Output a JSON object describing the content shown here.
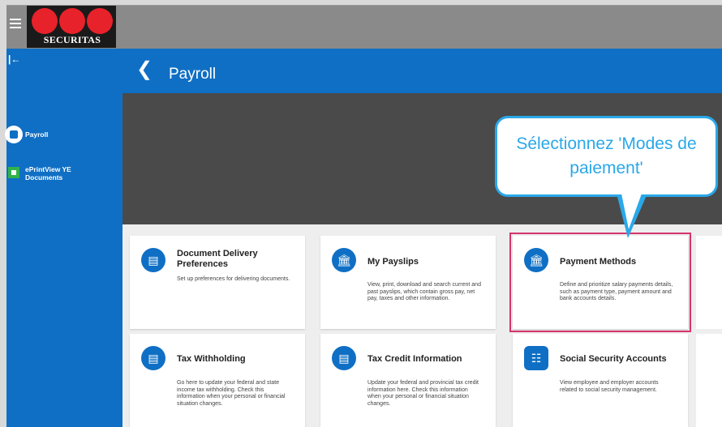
{
  "brand": {
    "wordmark": "SECURITAS",
    "accent": "#e8222a",
    "primary": "#0f6fc4"
  },
  "sidebar": {
    "collapse_icon": "collapse-left-icon",
    "items": [
      {
        "label": "Payroll",
        "icon": "payroll-icon"
      },
      {
        "label": "ePrintView YE Documents",
        "icon": "document-icon"
      }
    ]
  },
  "header": {
    "back_icon": "chevron-left-icon",
    "title": "Payroll"
  },
  "cards": [
    {
      "title": "Document Delivery Preferences",
      "icon": "document-icon",
      "description": "Set up preferences for delivering documents."
    },
    {
      "title": "My Payslips",
      "icon": "bank-icon",
      "description": "View, print, download and search current and past payslips, which contain gross pay, net pay, taxes and other information."
    },
    {
      "title": "Payment Methods",
      "icon": "bank-icon",
      "description": "Define and prioritize salary payments details, such as payment type, payment amount and bank accounts details."
    },
    {
      "title": "Tax Withholding",
      "icon": "document-icon",
      "description": "Go here to update your federal and state income tax withholding. Check this information when your personal or financial situation changes."
    },
    {
      "title": "Tax Credit Information",
      "icon": "document-icon",
      "description": "Update your federal and provincial tax credit information here. Check this information when your personal or financial situation changes."
    },
    {
      "title": "Social Security Accounts",
      "icon": "id-badge-icon",
      "description": "View employee and employer accounts related to social security management."
    }
  ],
  "callout": {
    "text": "Sélectionnez 'Modes de paiement'",
    "color": "#2aa8e8"
  },
  "highlight_color": "#d6336c"
}
